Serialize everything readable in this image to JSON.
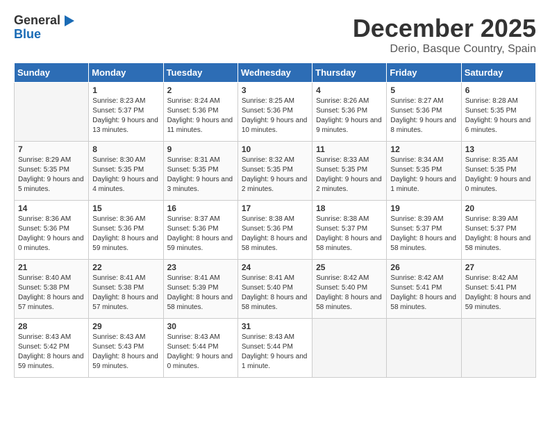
{
  "header": {
    "logo_general": "General",
    "logo_blue": "Blue",
    "month_year": "December 2025",
    "location": "Derio, Basque Country, Spain"
  },
  "weekdays": [
    "Sunday",
    "Monday",
    "Tuesday",
    "Wednesday",
    "Thursday",
    "Friday",
    "Saturday"
  ],
  "weeks": [
    [
      {
        "day": "",
        "sunrise": "",
        "sunset": "",
        "daylight": "",
        "empty": true
      },
      {
        "day": "1",
        "sunrise": "Sunrise: 8:23 AM",
        "sunset": "Sunset: 5:37 PM",
        "daylight": "Daylight: 9 hours and 13 minutes.",
        "empty": false
      },
      {
        "day": "2",
        "sunrise": "Sunrise: 8:24 AM",
        "sunset": "Sunset: 5:36 PM",
        "daylight": "Daylight: 9 hours and 11 minutes.",
        "empty": false
      },
      {
        "day": "3",
        "sunrise": "Sunrise: 8:25 AM",
        "sunset": "Sunset: 5:36 PM",
        "daylight": "Daylight: 9 hours and 10 minutes.",
        "empty": false
      },
      {
        "day": "4",
        "sunrise": "Sunrise: 8:26 AM",
        "sunset": "Sunset: 5:36 PM",
        "daylight": "Daylight: 9 hours and 9 minutes.",
        "empty": false
      },
      {
        "day": "5",
        "sunrise": "Sunrise: 8:27 AM",
        "sunset": "Sunset: 5:36 PM",
        "daylight": "Daylight: 9 hours and 8 minutes.",
        "empty": false
      },
      {
        "day": "6",
        "sunrise": "Sunrise: 8:28 AM",
        "sunset": "Sunset: 5:35 PM",
        "daylight": "Daylight: 9 hours and 6 minutes.",
        "empty": false
      }
    ],
    [
      {
        "day": "7",
        "sunrise": "Sunrise: 8:29 AM",
        "sunset": "Sunset: 5:35 PM",
        "daylight": "Daylight: 9 hours and 5 minutes.",
        "empty": false
      },
      {
        "day": "8",
        "sunrise": "Sunrise: 8:30 AM",
        "sunset": "Sunset: 5:35 PM",
        "daylight": "Daylight: 9 hours and 4 minutes.",
        "empty": false
      },
      {
        "day": "9",
        "sunrise": "Sunrise: 8:31 AM",
        "sunset": "Sunset: 5:35 PM",
        "daylight": "Daylight: 9 hours and 3 minutes.",
        "empty": false
      },
      {
        "day": "10",
        "sunrise": "Sunrise: 8:32 AM",
        "sunset": "Sunset: 5:35 PM",
        "daylight": "Daylight: 9 hours and 2 minutes.",
        "empty": false
      },
      {
        "day": "11",
        "sunrise": "Sunrise: 8:33 AM",
        "sunset": "Sunset: 5:35 PM",
        "daylight": "Daylight: 9 hours and 2 minutes.",
        "empty": false
      },
      {
        "day": "12",
        "sunrise": "Sunrise: 8:34 AM",
        "sunset": "Sunset: 5:35 PM",
        "daylight": "Daylight: 9 hours and 1 minute.",
        "empty": false
      },
      {
        "day": "13",
        "sunrise": "Sunrise: 8:35 AM",
        "sunset": "Sunset: 5:35 PM",
        "daylight": "Daylight: 9 hours and 0 minutes.",
        "empty": false
      }
    ],
    [
      {
        "day": "14",
        "sunrise": "Sunrise: 8:36 AM",
        "sunset": "Sunset: 5:36 PM",
        "daylight": "Daylight: 9 hours and 0 minutes.",
        "empty": false
      },
      {
        "day": "15",
        "sunrise": "Sunrise: 8:36 AM",
        "sunset": "Sunset: 5:36 PM",
        "daylight": "Daylight: 8 hours and 59 minutes.",
        "empty": false
      },
      {
        "day": "16",
        "sunrise": "Sunrise: 8:37 AM",
        "sunset": "Sunset: 5:36 PM",
        "daylight": "Daylight: 8 hours and 59 minutes.",
        "empty": false
      },
      {
        "day": "17",
        "sunrise": "Sunrise: 8:38 AM",
        "sunset": "Sunset: 5:36 PM",
        "daylight": "Daylight: 8 hours and 58 minutes.",
        "empty": false
      },
      {
        "day": "18",
        "sunrise": "Sunrise: 8:38 AM",
        "sunset": "Sunset: 5:37 PM",
        "daylight": "Daylight: 8 hours and 58 minutes.",
        "empty": false
      },
      {
        "day": "19",
        "sunrise": "Sunrise: 8:39 AM",
        "sunset": "Sunset: 5:37 PM",
        "daylight": "Daylight: 8 hours and 58 minutes.",
        "empty": false
      },
      {
        "day": "20",
        "sunrise": "Sunrise: 8:39 AM",
        "sunset": "Sunset: 5:37 PM",
        "daylight": "Daylight: 8 hours and 58 minutes.",
        "empty": false
      }
    ],
    [
      {
        "day": "21",
        "sunrise": "Sunrise: 8:40 AM",
        "sunset": "Sunset: 5:38 PM",
        "daylight": "Daylight: 8 hours and 57 minutes.",
        "empty": false
      },
      {
        "day": "22",
        "sunrise": "Sunrise: 8:41 AM",
        "sunset": "Sunset: 5:38 PM",
        "daylight": "Daylight: 8 hours and 57 minutes.",
        "empty": false
      },
      {
        "day": "23",
        "sunrise": "Sunrise: 8:41 AM",
        "sunset": "Sunset: 5:39 PM",
        "daylight": "Daylight: 8 hours and 58 minutes.",
        "empty": false
      },
      {
        "day": "24",
        "sunrise": "Sunrise: 8:41 AM",
        "sunset": "Sunset: 5:40 PM",
        "daylight": "Daylight: 8 hours and 58 minutes.",
        "empty": false
      },
      {
        "day": "25",
        "sunrise": "Sunrise: 8:42 AM",
        "sunset": "Sunset: 5:40 PM",
        "daylight": "Daylight: 8 hours and 58 minutes.",
        "empty": false
      },
      {
        "day": "26",
        "sunrise": "Sunrise: 8:42 AM",
        "sunset": "Sunset: 5:41 PM",
        "daylight": "Daylight: 8 hours and 58 minutes.",
        "empty": false
      },
      {
        "day": "27",
        "sunrise": "Sunrise: 8:42 AM",
        "sunset": "Sunset: 5:41 PM",
        "daylight": "Daylight: 8 hours and 59 minutes.",
        "empty": false
      }
    ],
    [
      {
        "day": "28",
        "sunrise": "Sunrise: 8:43 AM",
        "sunset": "Sunset: 5:42 PM",
        "daylight": "Daylight: 8 hours and 59 minutes.",
        "empty": false
      },
      {
        "day": "29",
        "sunrise": "Sunrise: 8:43 AM",
        "sunset": "Sunset: 5:43 PM",
        "daylight": "Daylight: 8 hours and 59 minutes.",
        "empty": false
      },
      {
        "day": "30",
        "sunrise": "Sunrise: 8:43 AM",
        "sunset": "Sunset: 5:44 PM",
        "daylight": "Daylight: 9 hours and 0 minutes.",
        "empty": false
      },
      {
        "day": "31",
        "sunrise": "Sunrise: 8:43 AM",
        "sunset": "Sunset: 5:44 PM",
        "daylight": "Daylight: 9 hours and 1 minute.",
        "empty": false
      },
      {
        "day": "",
        "sunrise": "",
        "sunset": "",
        "daylight": "",
        "empty": true
      },
      {
        "day": "",
        "sunrise": "",
        "sunset": "",
        "daylight": "",
        "empty": true
      },
      {
        "day": "",
        "sunrise": "",
        "sunset": "",
        "daylight": "",
        "empty": true
      }
    ]
  ]
}
